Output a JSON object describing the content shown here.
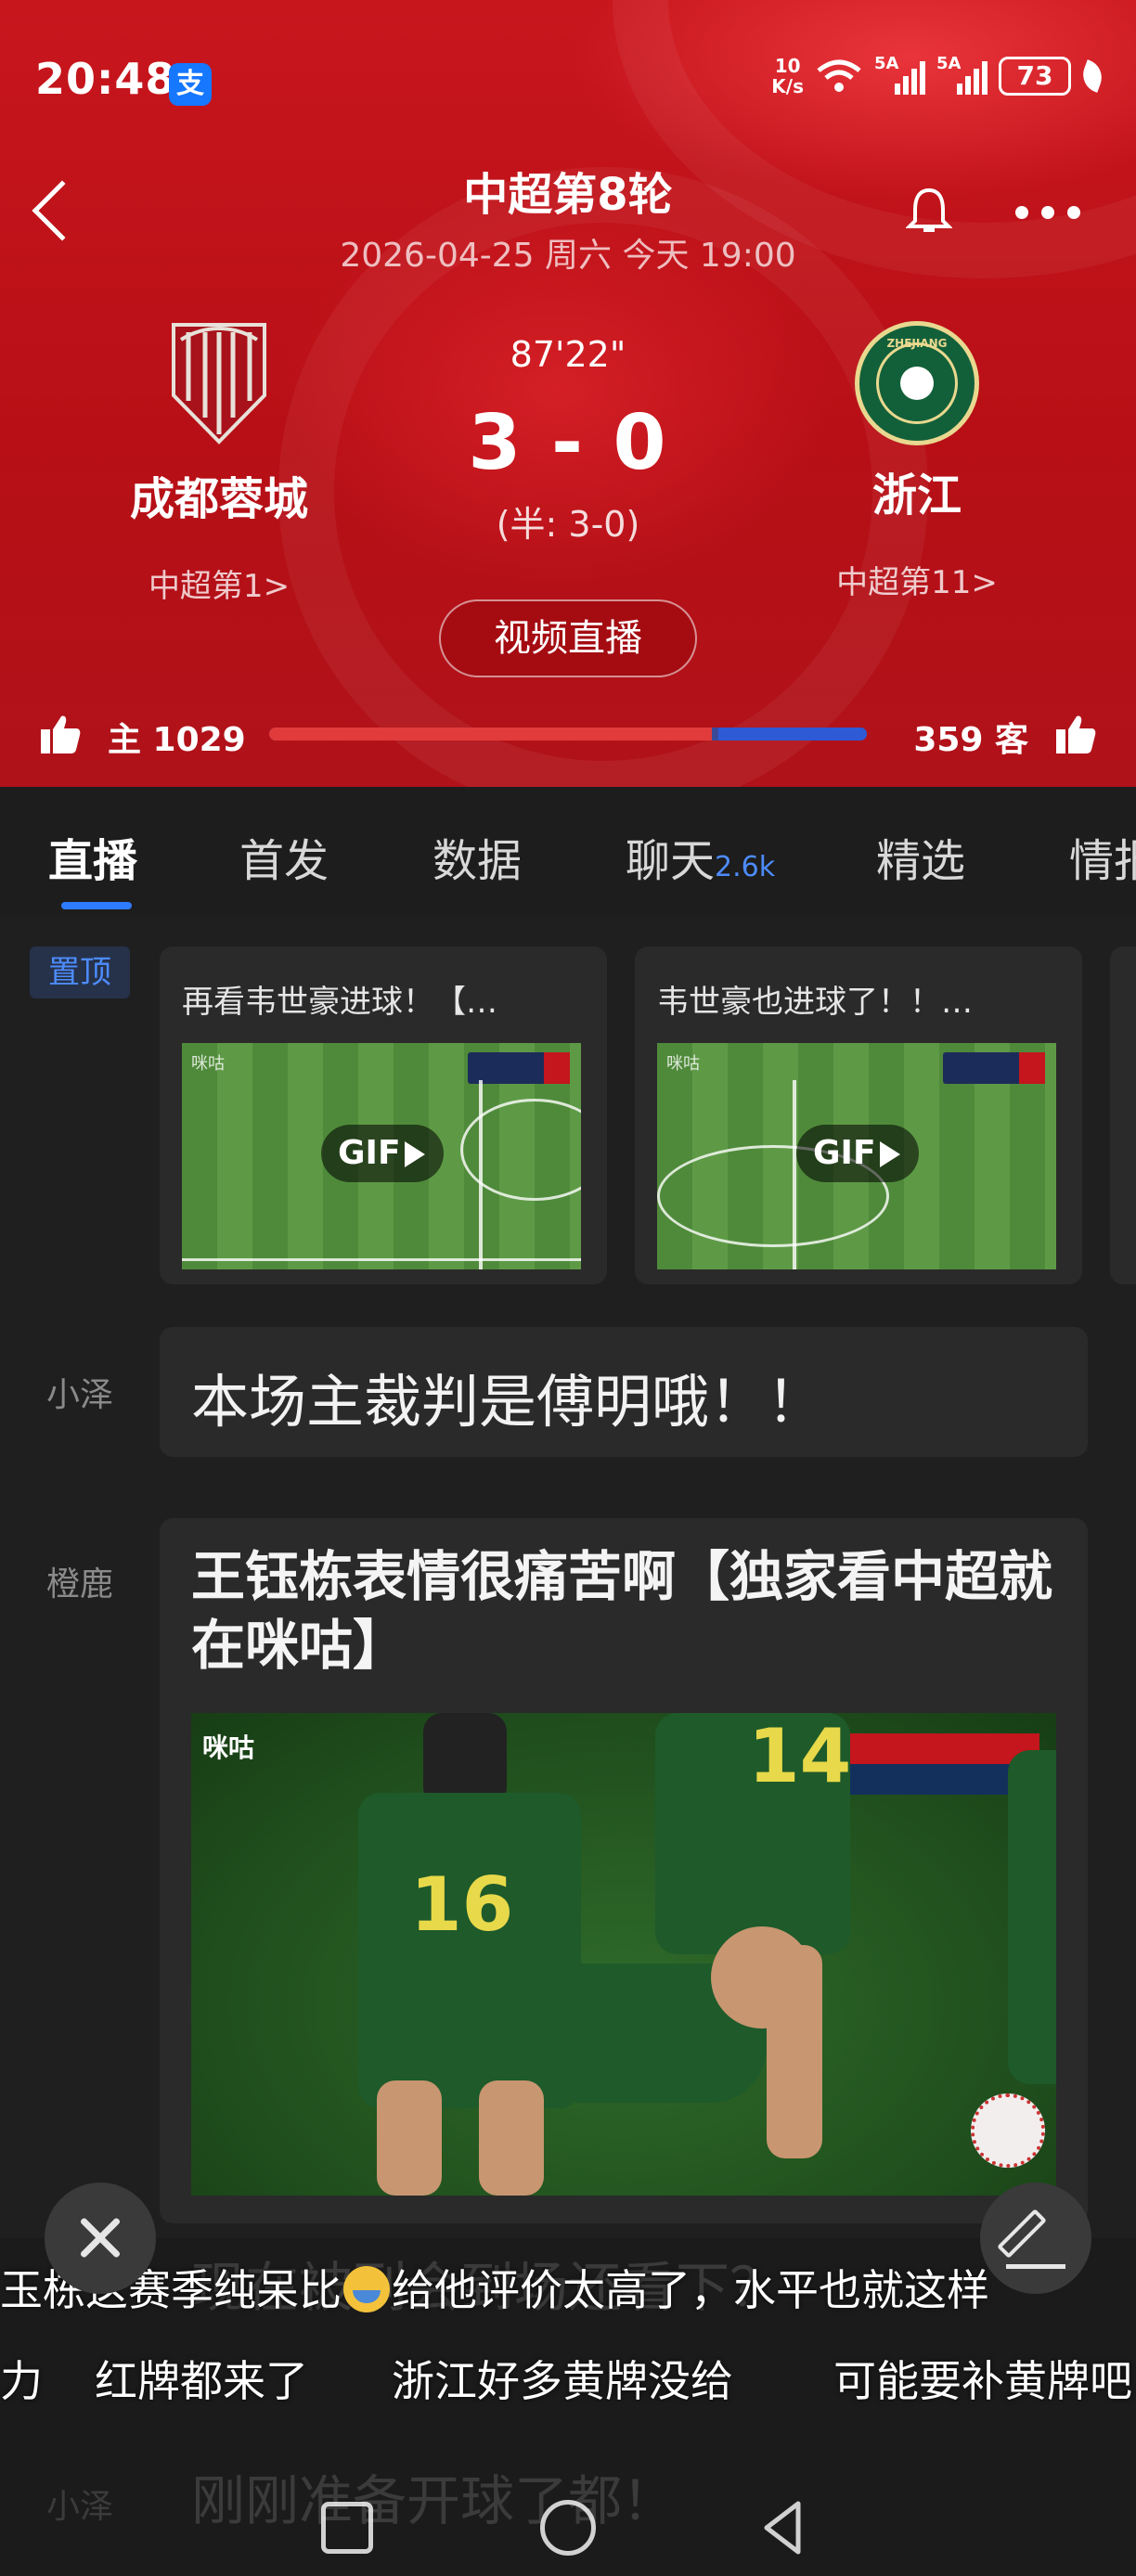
{
  "status_bar": {
    "time": "20:48",
    "alipay_badge": "支",
    "net_speed_top": "10",
    "net_speed_bottom": "K/s",
    "sim1": "5A",
    "sim2": "5A",
    "battery": "73"
  },
  "header": {
    "title": "中超第8轮",
    "subtitle": "2026-04-25 周六 今天 19:00"
  },
  "match": {
    "minute": "87'22\"",
    "score": "3 - 0",
    "half_score": "(半: 3-0)",
    "home_team": {
      "name": "成都蓉城",
      "rank": "中超第1>"
    },
    "away_team": {
      "name": "浙江",
      "rank": "中超第11>",
      "crest_text": "ZHEJIANG"
    },
    "live_button": "视频直播"
  },
  "support": {
    "home_label": "主 1029",
    "away_label": "359 客",
    "home_count": 1029,
    "away_count": 359,
    "home_color": "#e23b3b",
    "away_color": "#2e5ad6"
  },
  "tabs": [
    {
      "label": "直播",
      "active": true
    },
    {
      "label": "首发"
    },
    {
      "label": "数据"
    },
    {
      "label": "聊天",
      "count": "2.6k"
    },
    {
      "label": "精选"
    },
    {
      "label": "情报"
    }
  ],
  "feed": {
    "pinned_label": "置顶",
    "pinned_videos": [
      {
        "caption": "再看韦世豪进球！【…",
        "badge": "GIF",
        "watermark": "咪咕"
      },
      {
        "caption": "韦世豪也进球了！！…",
        "badge": "GIF",
        "watermark": "咪咕"
      }
    ],
    "messages": [
      {
        "author": "小泽",
        "text": "本场主裁判是傅明哦！！"
      },
      {
        "author": "橙鹿",
        "text": "王钰栋表情很痛苦啊【独家看中超就在咪咕】",
        "photo_watermark": "咪咕"
      }
    ]
  },
  "danmaku": {
    "line1": "玉栋这赛季纯呆比",
    "line1_tail": "给他评价太高了，水平也就这样",
    "line2": [
      "力",
      "红牌都来了",
      "浙江好多黄牌没给",
      "可能要补黄牌吧"
    ],
    "ghost_line1": "现在被列会到场还看下？",
    "ghost_author": "小泽",
    "ghost_line2": "刚刚准备开球了都！"
  },
  "colors": {
    "header_red": "#c8161d",
    "accent_blue": "#2f7bff",
    "bg_dark": "#1f1f1f",
    "card_bg": "#2a2a2a"
  }
}
